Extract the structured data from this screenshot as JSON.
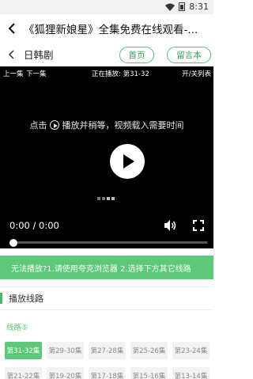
{
  "status": {
    "time": "8:31"
  },
  "header": {
    "title": "《狐狸新娘星》全集免费在线观看-..."
  },
  "subnav": {
    "category": "日韩剧",
    "home_label": "首页",
    "message_label": "留言本"
  },
  "player": {
    "prev_label": "上一集",
    "next_label": "下一集",
    "now_playing": "正在播放: 第31-32",
    "toggle_list": "开/关列表",
    "hint_prefix": "点击",
    "hint_suffix": "播放并稍等，视频载入需要时间",
    "timecode": "0:00 / 0:00",
    "progress": 0
  },
  "notice": "无法播放?1.请使用夸克浏览器 2.选择下方其它线路",
  "section": {
    "label": "播放线路"
  },
  "lines": {
    "label": "线路⑤"
  },
  "episodes": [
    "第31-32集",
    "第29-30集",
    "第27-28集",
    "第25-26集",
    "第23-24集",
    "第21-22集",
    "第19-20集",
    "第17-18集",
    "第15-16集",
    "第13-14集"
  ],
  "active_episode_index": 0,
  "colors": {
    "accent": "#5cc878",
    "player_bg": "#000000"
  }
}
